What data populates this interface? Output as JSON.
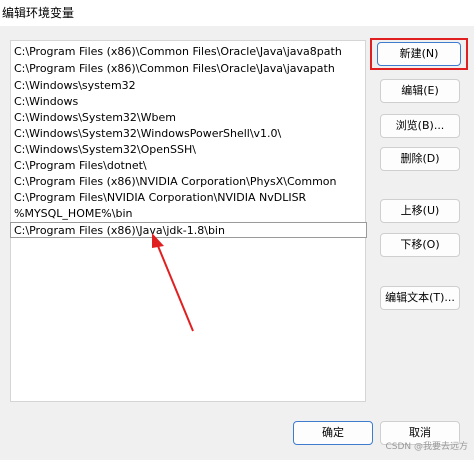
{
  "window": {
    "title": "编辑环境变量"
  },
  "paths": [
    "C:\\Program Files (x86)\\Common Files\\Oracle\\Java\\java8path",
    "C:\\Program Files (x86)\\Common Files\\Oracle\\Java\\javapath",
    "C:\\Windows\\system32",
    "C:\\Windows",
    "C:\\Windows\\System32\\Wbem",
    "C:\\Windows\\System32\\WindowsPowerShell\\v1.0\\",
    "C:\\Windows\\System32\\OpenSSH\\",
    "C:\\Program Files\\dotnet\\",
    "C:\\Program Files (x86)\\NVIDIA Corporation\\PhysX\\Common",
    "C:\\Program Files\\NVIDIA Corporation\\NVIDIA NvDLISR",
    "%MYSQL_HOME%\\bin",
    "C:\\Program Files (x86)\\Java\\jdk-1.8\\bin"
  ],
  "buttons": {
    "new": "新建(N)",
    "edit": "编辑(E)",
    "browse": "浏览(B)...",
    "delete": "删除(D)",
    "move_up": "上移(U)",
    "move_down": "下移(O)",
    "edit_text": "编辑文本(T)..."
  },
  "footer": {
    "ok": "确定",
    "cancel": "取消"
  },
  "watermark": "CSDN @我要去远方",
  "colors": {
    "annotation": "#e02020"
  }
}
